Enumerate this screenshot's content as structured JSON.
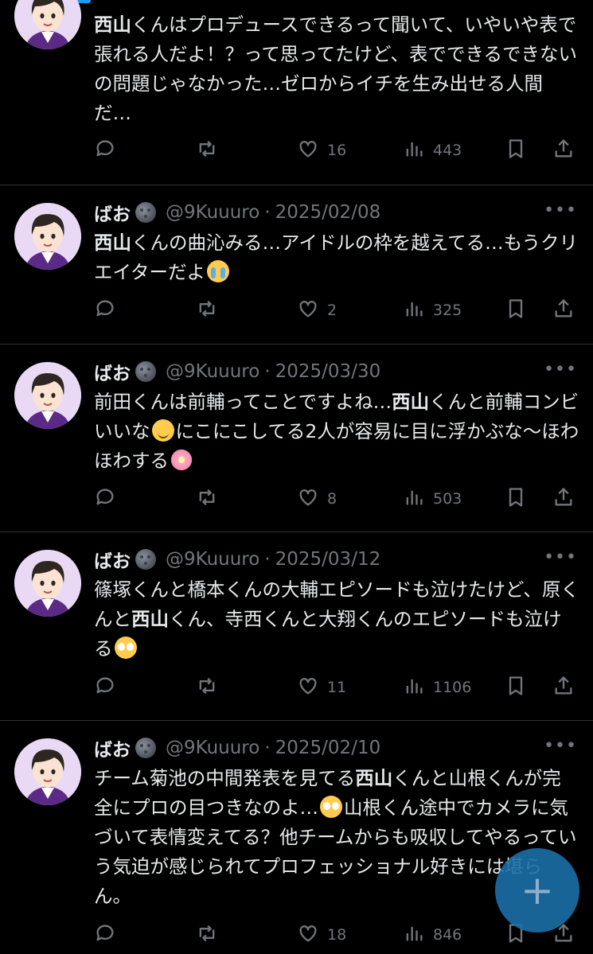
{
  "fab": {
    "icon": "compose-plus-icon",
    "label": "+"
  },
  "tweets": [
    {
      "name": "",
      "handle": "",
      "date": "",
      "text_html": "<b>西山</b>くんはプロデュースできるって聞いて、いやいや表で張れる人だよ！？って思ってたけど、表でできるできないの問題じゃなかった…ゼロからイチを生み出せる人間だ…",
      "likes": "16",
      "views": "443"
    },
    {
      "name": "ばお",
      "handle": "@9Kuuuro",
      "date": "2025/02/08",
      "text_html": "<b>西山</b>くんの曲沁みる…アイドルの枠を越えてる…もうクリエイターだよ<span class=\"emoji emoji-cry\" data-name=\"crying-emoji-icon\"></span>",
      "likes": "2",
      "views": "325"
    },
    {
      "name": "ばお",
      "handle": "@9Kuuuro",
      "date": "2025/03/30",
      "text_html": "前田くんは前輔ってことですよね…<b>西山</b>くんと前輔コンビいいな<span class=\"emoji emoji-smile\" data-name=\"smiling-emoji-icon\"></span>にこにこしてる2人が容易に目に浮かぶな〜ほわほわする<span class=\"emoji emoji-blossom\" data-name=\"cherry-blossom-emoji-icon\"></span>",
      "likes": "8",
      "views": "503"
    },
    {
      "name": "ばお",
      "handle": "@9Kuuuro",
      "date": "2025/03/12",
      "text_html": "篠塚くんと橋本くんの大輔エピソードも泣けたけど、原くんと<b>西山</b>くん、寺西くんと大翔くんのエピソードも泣ける<span class=\"emoji emoji-plead\" data-name=\"pleading-emoji-icon\"></span>",
      "likes": "11",
      "views": "1106"
    },
    {
      "name": "ばお",
      "handle": "@9Kuuuro",
      "date": "2025/02/10",
      "text_html": "チーム菊池の中間発表を見てる<b>西山</b>くんと山根くんが完全にプロの目つきなのよ…<span class=\"emoji emoji-plead\" data-name=\"pleading-emoji-icon\"></span>山根くん途中でカメラに気づいて表情変えてる？他チームからも吸収してやるっていう気迫が感じられてプロフェッショナル好きには堪らん。",
      "likes": "18",
      "views": "846"
    }
  ],
  "colors": {
    "accent": "#1d9bf0",
    "muted": "#71767b",
    "text": "#e7e9ea",
    "divider": "#2f3336",
    "fab": "#1b6fa8"
  }
}
